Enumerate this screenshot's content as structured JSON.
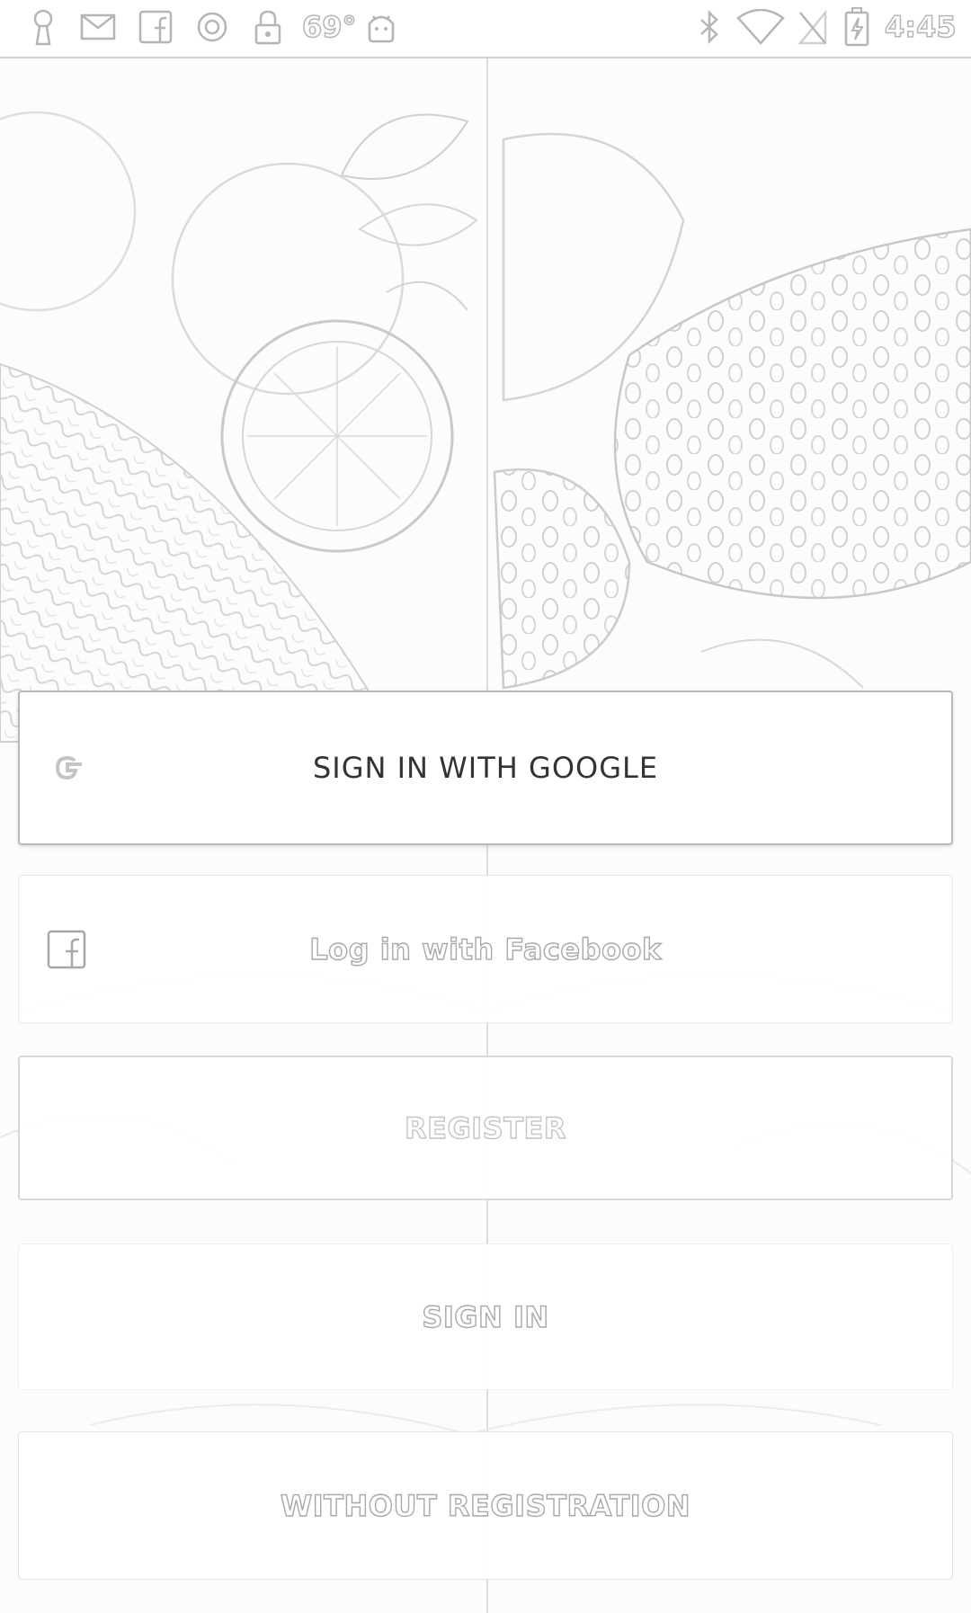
{
  "status_bar": {
    "temperature": "69°",
    "time": "4:45",
    "left_icons": [
      "keyhole-icon",
      "mail-icon",
      "facebook-icon",
      "data-saver-icon",
      "lock-icon",
      "android-icon"
    ],
    "right_icons": [
      "bluetooth-icon",
      "wifi-icon",
      "no-sim-icon",
      "battery-charging-icon"
    ]
  },
  "buttons": {
    "google": {
      "label": "SIGN IN WITH GOOGLE",
      "icon": "google-icon"
    },
    "facebook": {
      "label": "Log in with Facebook",
      "icon": "facebook-icon"
    },
    "register": {
      "label": "REGISTER"
    },
    "sign_in": {
      "label": "SIGN IN"
    },
    "without_registration": {
      "label": "WITHOUT REGISTRATION"
    }
  },
  "colors": {
    "border": "#b9b9b9",
    "text_dark": "#333333",
    "outline_text": "#a8a8a8",
    "background": "#fbfbfb"
  }
}
